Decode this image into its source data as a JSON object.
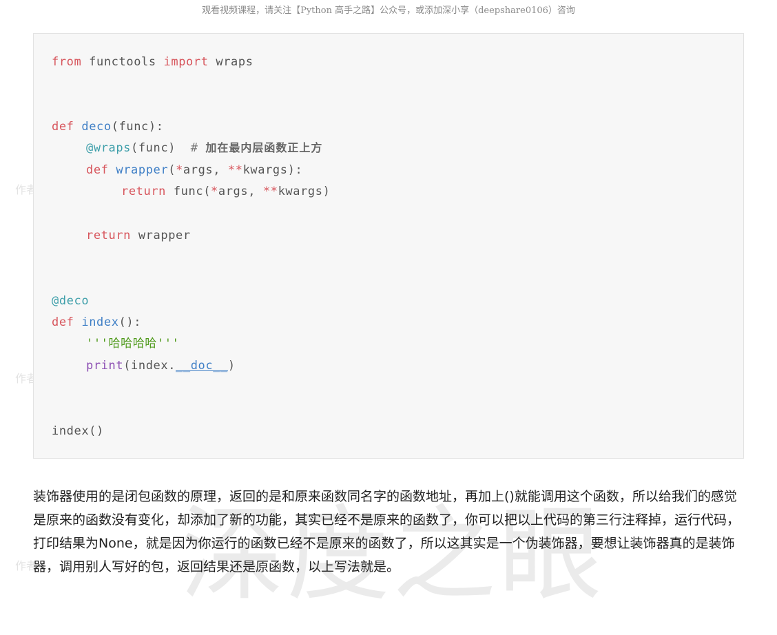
{
  "header": {
    "text": "观看视频课程，请关注【Python 高手之路】公众号，或添加深小享（deepshare0106）咨询"
  },
  "watermark": {
    "big_text": "深度之眼",
    "small_text": "作者"
  },
  "code": {
    "l1": {
      "kw1": "from",
      "mod": " functools ",
      "kw2": "import",
      "name": " wraps"
    },
    "l2": {
      "kw": "def",
      "fn": "deco",
      "rest": "(func):"
    },
    "l3": {
      "dec": "@wraps",
      "rest": "(func)  ",
      "hash": "# ",
      "comment": "加在最内层函数正上方"
    },
    "l4": {
      "kw": "def",
      "fn": "wrapper",
      "p1": "(",
      "star1": "*",
      "p2": "args, ",
      "star2": "**",
      "p3": "kwargs):"
    },
    "l5": {
      "kw": "return",
      "p1": " func(",
      "star1": "*",
      "p2": "args, ",
      "star2": "**",
      "p3": "kwargs)"
    },
    "l6": {
      "kw": "return",
      "rest": " wrapper"
    },
    "l7": {
      "dec": "@deco"
    },
    "l8": {
      "kw": "def",
      "fn": "index",
      "rest": "():"
    },
    "l9": {
      "str": "'''哈哈哈哈'''"
    },
    "l10": {
      "builtin": "print",
      "p1": "(index.",
      "dunder": "__doc__",
      "p2": ")"
    },
    "l11": {
      "text": "index()"
    }
  },
  "paragraph": {
    "text": "装饰器使用的是闭包函数的原理，返回的是和原来函数同名字的函数地址，再加上()就能调用这个函数，所以给我们的感觉是原来的函数没有变化，却添加了新的功能，其实已经不是原来的函数了，你可以把以上代码的第三行注释掉，运行代码，打印结果为None，就是因为你运行的函数已经不是原来的函数了，所以这其实是一个伪装饰器，要想让装饰器真的是装饰器，调用别人写好的包，返回结果还是原函数，以上写法就是。"
  }
}
